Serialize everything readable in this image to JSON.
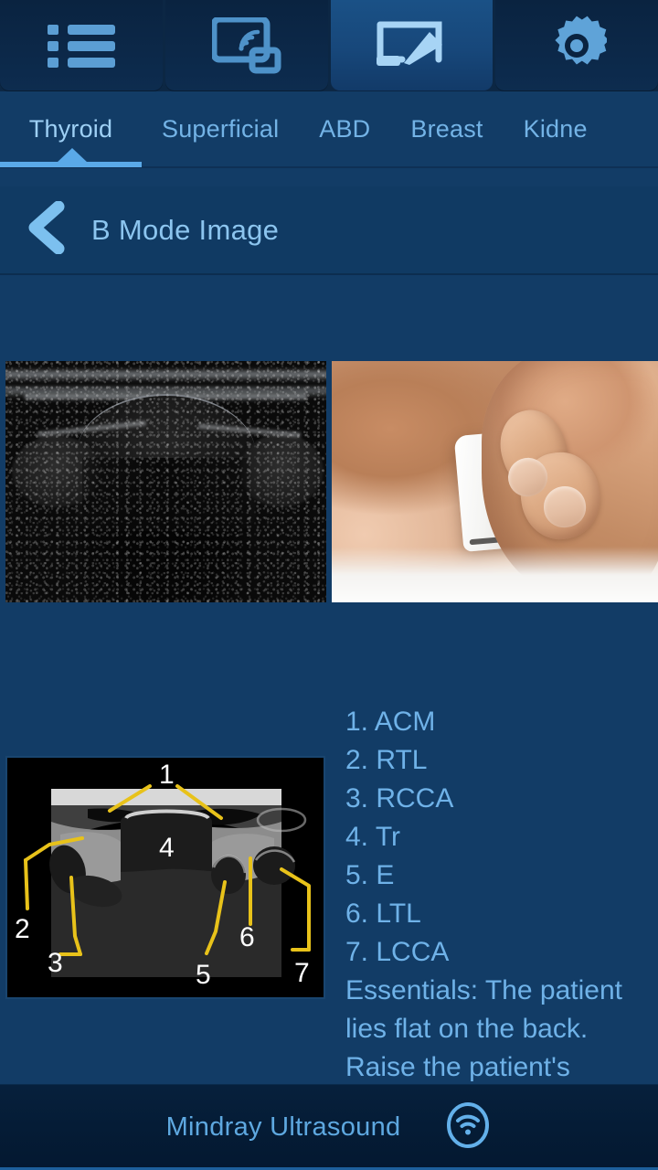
{
  "app": {
    "accent": "#5aa9e8",
    "background": "#123c66",
    "text_color": "#6fb2e8"
  },
  "topbar": {
    "tabs": [
      {
        "icon": "list-icon",
        "label": "List",
        "selected": false
      },
      {
        "icon": "screen-cast-icon",
        "label": "Cast",
        "selected": false
      },
      {
        "icon": "whiteboard-pencil-icon",
        "label": "Annotate",
        "selected": true
      },
      {
        "icon": "gear-icon",
        "label": "Settings",
        "selected": false
      }
    ]
  },
  "categories": {
    "items": [
      {
        "label": "Thyroid",
        "selected": true
      },
      {
        "label": "Superficial",
        "selected": false
      },
      {
        "label": "ABD",
        "selected": false
      },
      {
        "label": "Breast",
        "selected": false
      },
      {
        "label": "Kidne",
        "selected": false
      }
    ]
  },
  "header": {
    "back_icon": "back-chevron-icon",
    "title": "B Mode Image"
  },
  "media": {
    "ultrasound_alt": "Thyroid B mode ultrasound image",
    "photo_alt": "Probe placement photo on patient neck"
  },
  "diagram": {
    "alt": "Thyroid cross-section anatomy diagram",
    "labels": [
      "1",
      "2",
      "3",
      "4",
      "5",
      "6",
      "7"
    ],
    "label_color": "#ffffff",
    "leader_color": "#e8c21a"
  },
  "notes": {
    "legend": [
      "1. ACM",
      "2. RTL",
      "3. RCCA",
      "4. Tr",
      "5. E",
      "6. LTL",
      "7. LCCA"
    ],
    "essentials": "Essentials: The patient lies flat on the back. Raise the patient's"
  },
  "footer": {
    "brand": "Mindray Ultrasound",
    "wifi_icon": "wifi-circle-icon"
  }
}
